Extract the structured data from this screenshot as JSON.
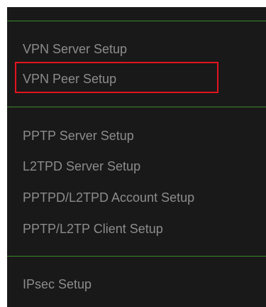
{
  "menu": {
    "groups": [
      {
        "items": [
          {
            "label": "VPN Server Setup"
          },
          {
            "label": "VPN Peer Setup",
            "highlighted": true
          }
        ]
      },
      {
        "items": [
          {
            "label": "PPTP Server Setup"
          },
          {
            "label": "L2TPD Server Setup"
          },
          {
            "label": "PPTPD/L2TPD Account Setup"
          },
          {
            "label": "PPTP/L2TP Client Setup"
          }
        ]
      },
      {
        "items": [
          {
            "label": "IPsec Setup"
          }
        ]
      }
    ]
  },
  "colors": {
    "panel_background": "#191919",
    "item_text": "#8c8c8c",
    "divider": "#3a8a2a",
    "highlight_border": "#e3141f",
    "page_background": "#ffffff"
  }
}
